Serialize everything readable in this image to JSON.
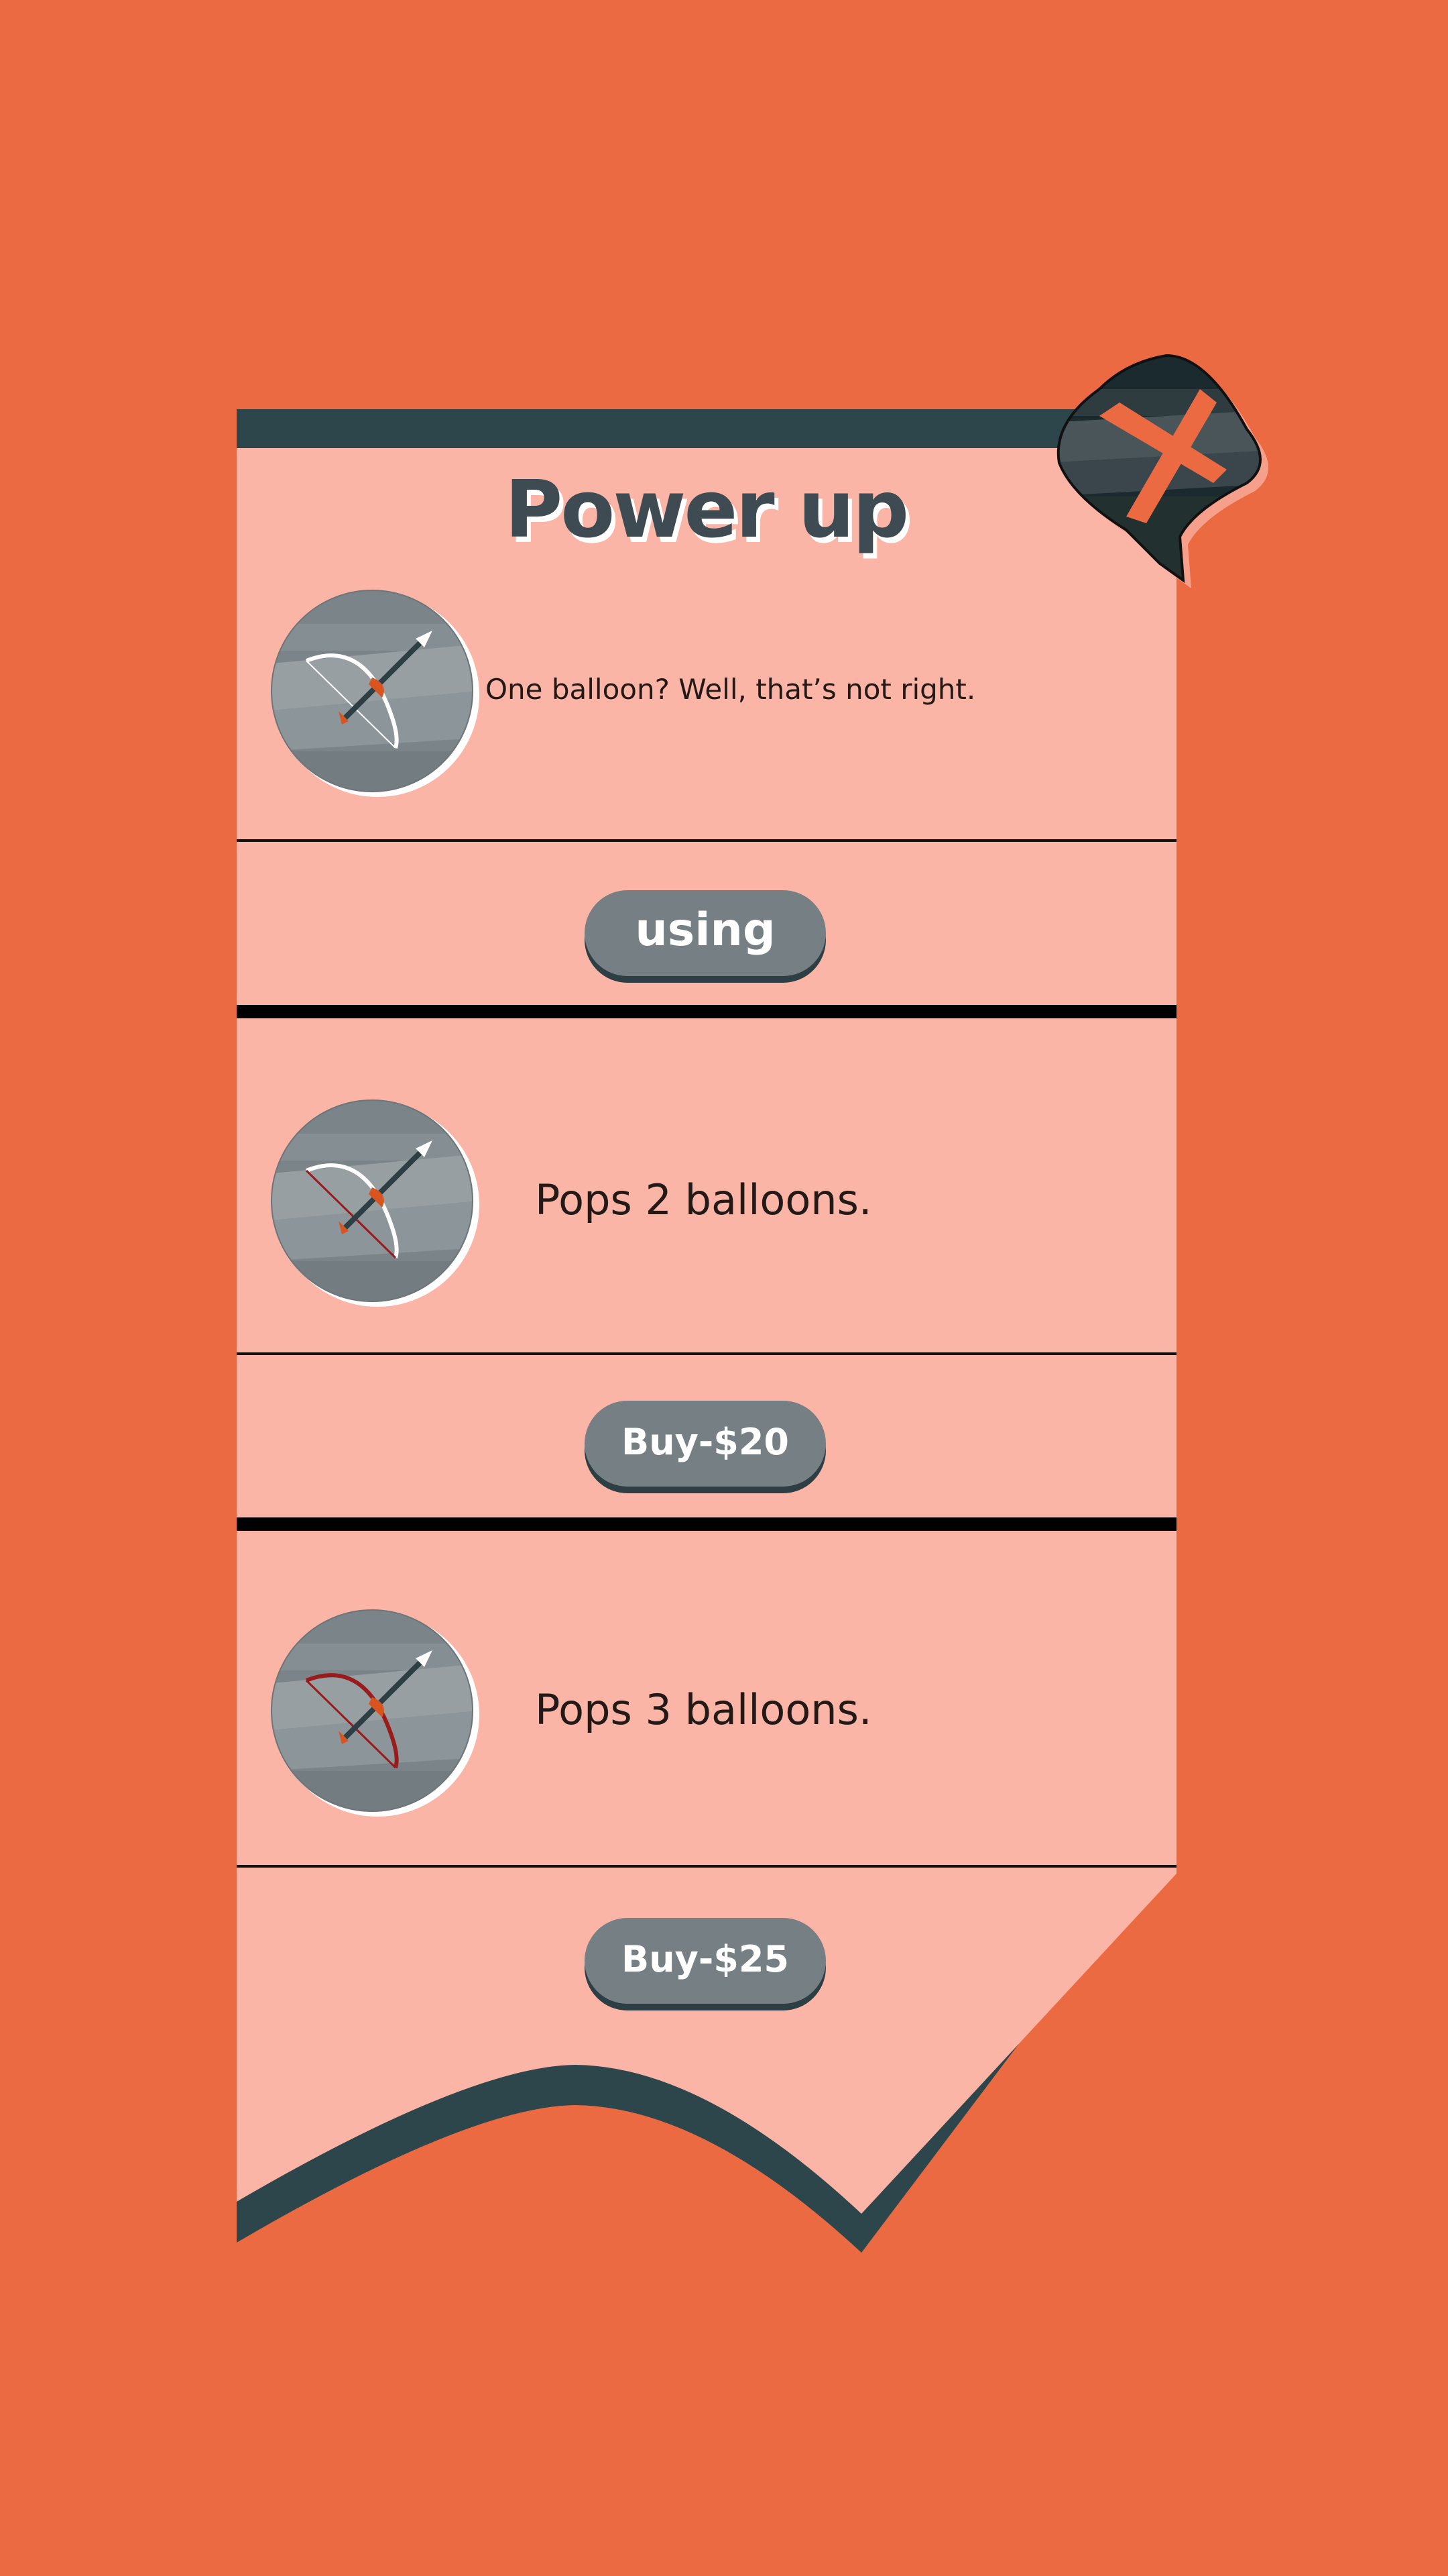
{
  "title": "Power up",
  "items": [
    {
      "description": "One balloon? Well, that’s not right.",
      "button_label": "using",
      "state": "in-use"
    },
    {
      "description": "Pops 2 balloons.",
      "button_label": "Buy-$20",
      "state": "purchasable"
    },
    {
      "description": "Pops 3 balloons.",
      "button_label": "Buy-$25",
      "state": "purchasable"
    }
  ],
  "icons": {
    "item_icon": "bow-and-arrow-icon",
    "close": "close-x-icon"
  },
  "colors": {
    "background": "#ec6a41",
    "panel": "#fbb5a6",
    "panel_border": "#2d464b",
    "button": "#767f84",
    "title": "#3e4b52"
  }
}
